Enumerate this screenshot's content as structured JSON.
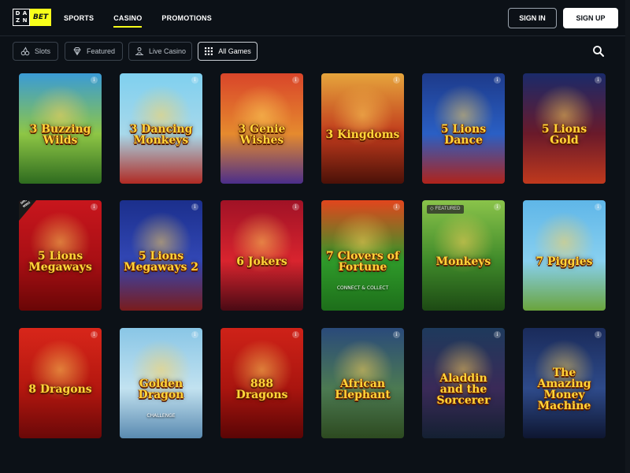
{
  "logo": {
    "left": "DA ZN",
    "right": "BET",
    "dazn_letters": [
      "D",
      "A",
      "Z",
      "N"
    ]
  },
  "nav": [
    {
      "label": "SPORTS",
      "active": false
    },
    {
      "label": "CASINO",
      "active": true
    },
    {
      "label": "PROMOTIONS",
      "active": false
    }
  ],
  "auth": {
    "signin_label": "SIGN IN",
    "signup_label": "SIGN UP"
  },
  "filters": [
    {
      "label": "Slots",
      "icon": "cherries-icon",
      "active": false
    },
    {
      "label": "Featured",
      "icon": "diamond-icon",
      "active": false
    },
    {
      "label": "Live Casino",
      "icon": "dealer-icon",
      "active": false
    },
    {
      "label": "All Games",
      "icon": "grid-icon",
      "active": true
    }
  ],
  "search_icon": "search-icon",
  "colors": {
    "background": "#0c1117",
    "accent": "#f7ff1a",
    "chip_border": "#3a424c"
  },
  "games": [
    {
      "title": "3 Buzzing\nWilds",
      "sub": "",
      "badge": "",
      "corner": "",
      "bg": [
        "#3a9bd6",
        "#8ec645",
        "#2e6b1f"
      ]
    },
    {
      "title": "3 Dancing\nMonkeys",
      "sub": "",
      "badge": "",
      "corner": "",
      "bg": [
        "#7fd0ef",
        "#a7d8ea",
        "#b02a23"
      ]
    },
    {
      "title": "3 Genie\nWishes",
      "sub": "",
      "badge": "",
      "corner": "",
      "bg": [
        "#d9452a",
        "#e58a2e",
        "#4b2e8a"
      ]
    },
    {
      "title": "3 Kingdoms",
      "sub": "",
      "badge": "",
      "corner": "",
      "bg": [
        "#e6a53c",
        "#c03a1c",
        "#4a1108"
      ]
    },
    {
      "title": "5 Lions\nDance",
      "sub": "",
      "badge": "",
      "corner": "",
      "bg": [
        "#1d3a8a",
        "#2a5fc4",
        "#b0231a"
      ]
    },
    {
      "title": "5 Lions\nGold",
      "sub": "",
      "badge": "",
      "corner": "",
      "bg": [
        "#1a2a6a",
        "#6a1a2a",
        "#c0391d"
      ]
    },
    {
      "title": "5 Lions\nMegaways",
      "sub": "",
      "badge": "",
      "corner": "DROPS & WINS",
      "bg": [
        "#c8161d",
        "#a80f14",
        "#6a0606"
      ]
    },
    {
      "title": "5 Lions\nMegaways 2",
      "sub": "",
      "badge": "",
      "corner": "",
      "bg": [
        "#1b2f8c",
        "#3247b5",
        "#7a1c1c"
      ]
    },
    {
      "title": "6 Jokers",
      "sub": "",
      "badge": "",
      "corner": "",
      "bg": [
        "#a01226",
        "#d8242e",
        "#4a0a14"
      ]
    },
    {
      "title": "7 Clovers of\nFortune",
      "sub": "CONNECT & COLLECT",
      "badge": "",
      "corner": "",
      "bg": [
        "#e2451d",
        "#2f9a2a",
        "#1d6e1a"
      ]
    },
    {
      "title": "Monkeys",
      "sub": "",
      "badge": "FEATURED",
      "corner": "",
      "bg": [
        "#8ac34a",
        "#3f8a2a",
        "#1d4a14"
      ]
    },
    {
      "title": "7 Piggies",
      "sub": "",
      "badge": "",
      "corner": "",
      "bg": [
        "#5fb6e8",
        "#88d0f0",
        "#6aa43c"
      ]
    },
    {
      "title": "8 Dragons",
      "sub": "",
      "badge": "",
      "corner": "",
      "bg": [
        "#d8261a",
        "#b3170f",
        "#6a0808"
      ]
    },
    {
      "title": "Golden Dragon",
      "sub": "CHALLENGE",
      "badge": "",
      "corner": "",
      "bg": [
        "#89c6e6",
        "#c2e2f0",
        "#5a8ab0"
      ]
    },
    {
      "title": "888 Dragons",
      "sub": "",
      "badge": "",
      "corner": "",
      "bg": [
        "#cf2218",
        "#a9150f",
        "#5a0505"
      ]
    },
    {
      "title": "African\nElephant",
      "sub": "",
      "badge": "",
      "corner": "",
      "bg": [
        "#2a4a7a",
        "#4c7a52",
        "#2d4a20"
      ]
    },
    {
      "title": "Aladdin\nand the Sorcerer",
      "sub": "",
      "badge": "",
      "corner": "",
      "bg": [
        "#1e3a5c",
        "#3a2a58",
        "#142032"
      ]
    },
    {
      "title": "The Amazing\nMoney\nMachine",
      "sub": "",
      "badge": "",
      "corner": "",
      "bg": [
        "#1a2b5a",
        "#2e4a8a",
        "#0e1630"
      ]
    }
  ]
}
